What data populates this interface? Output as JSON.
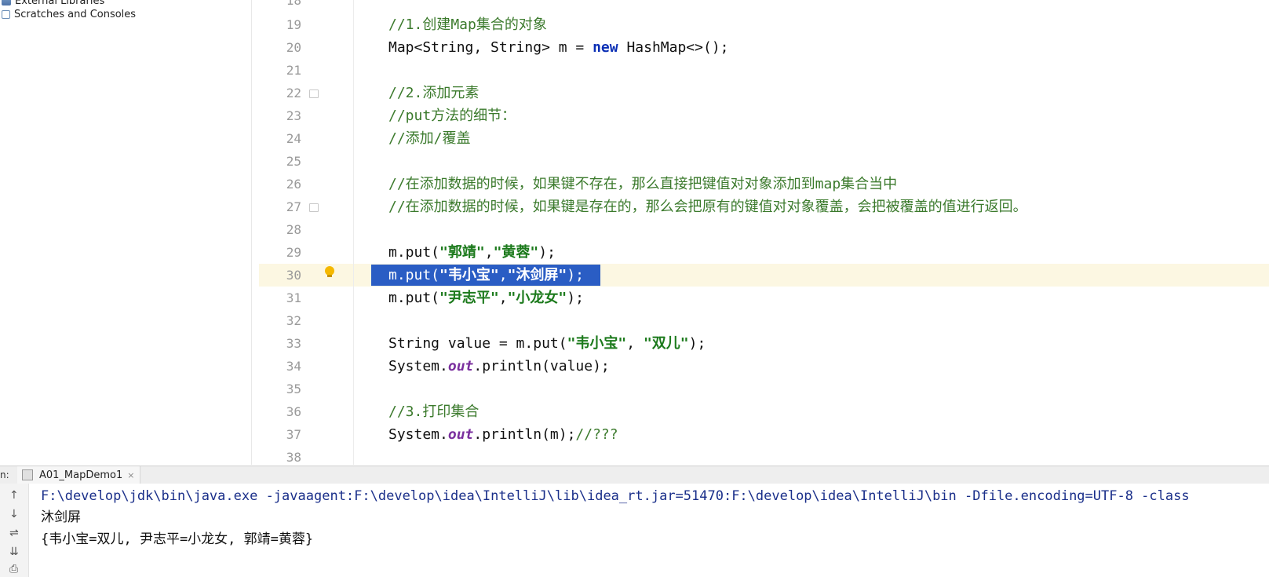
{
  "project_tree": {
    "items": [
      {
        "label": "External Libraries",
        "icon": "library-icon"
      },
      {
        "label": "Scratches and Consoles",
        "icon": "scratches-icon"
      }
    ]
  },
  "editor": {
    "line_numbers": [
      "18",
      "19",
      "20",
      "21",
      "22",
      "23",
      "24",
      "25",
      "26",
      "27",
      "28",
      "29",
      "30",
      "31",
      "32",
      "33",
      "34",
      "35",
      "36",
      "37",
      "38"
    ],
    "current_line": "30",
    "code": {
      "l19_comment": "//1.创建Map集合的对象",
      "l20_a": "Map<String, String> m = ",
      "l20_kw": "new",
      "l20_b": " HashMap<>();",
      "l22_comment": "//2.添加元素",
      "l23_comment": "//put方法的细节：",
      "l24_comment": "//添加/覆盖",
      "l26_comment": "//在添加数据的时候，如果键不存在，那么直接把键值对对象添加到map集合当中",
      "l27_comment": "//在添加数据的时候，如果键是存在的，那么会把原有的键值对对象覆盖，会把被覆盖的值进行返回。",
      "l29_a": "m.put(",
      "l29_s1": "\"郭靖\"",
      "l29_b": ",",
      "l29_s2": "\"黄蓉\"",
      "l29_c": ");",
      "l30_a": "m.put(",
      "l30_s1": "\"韦小宝\"",
      "l30_b": ",",
      "l30_s2": "\"沐剑屏\"",
      "l30_c": ");",
      "l31_a": "m.put(",
      "l31_s1": "\"尹志平\"",
      "l31_b": ",",
      "l31_s2": "\"小龙女\"",
      "l31_c": ");",
      "l33_a": "String value = m.put(",
      "l33_s1": "\"韦小宝\"",
      "l33_b": ", ",
      "l33_s2": "\"双儿\"",
      "l33_c": ");",
      "l34_a": "System.",
      "l34_field": "out",
      "l34_b": ".println(value);",
      "l36_comment": "//3.打印集合",
      "l37_a": "System.",
      "l37_field": "out",
      "l37_b": ".println(m);",
      "l37_comment": "//???"
    }
  },
  "run_panel": {
    "label": "n:",
    "tab_label": "A01_MapDemo1",
    "tab_close": "×",
    "tools": [
      "↑",
      "↓",
      "⇌",
      "⇊",
      "⎙"
    ],
    "output": [
      "F:\\develop\\jdk\\bin\\java.exe -javaagent:F:\\develop\\idea\\IntelliJ\\lib\\idea_rt.jar=51470:F:\\develop\\idea\\IntelliJ\\bin -Dfile.encoding=UTF-8 -class",
      "沐剑屏",
      "{韦小宝=双儿, 尹志平=小龙女, 郭靖=黄蓉}"
    ]
  },
  "colors": {
    "selection": "#2a5dc4",
    "current_line": "#fcf7e2",
    "comment": "#3b7a2c",
    "keyword": "#0b2fb5",
    "string": "#1c7a1c"
  }
}
